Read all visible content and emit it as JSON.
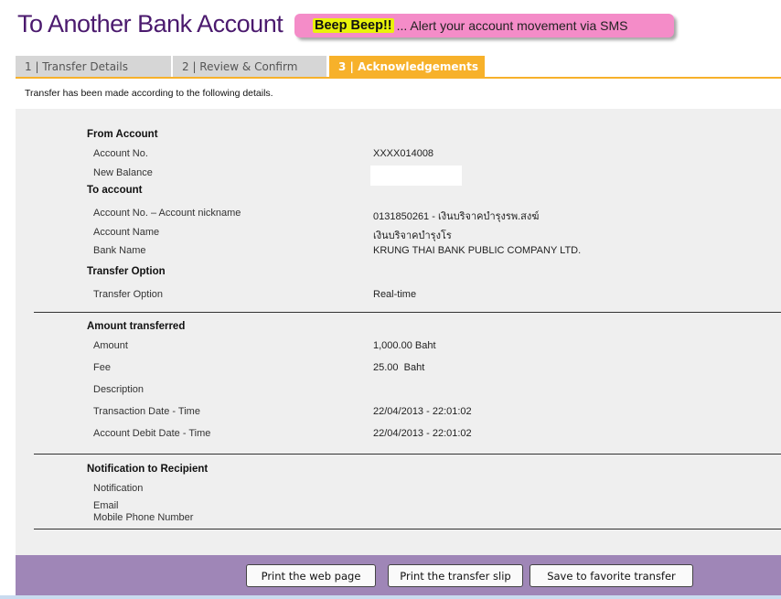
{
  "page": {
    "title": "To Another Bank Account",
    "banner": {
      "highlight": "Beep Beep!!",
      "text": "... Alert your account movement via SMS"
    }
  },
  "tabs": [
    {
      "label": "1 | Transfer Details"
    },
    {
      "label": "2 | Review & Confirm"
    },
    {
      "label": "3 | Acknowledgements"
    }
  ],
  "intro": "Transfer has been made according to the following details.",
  "from_account": {
    "heading": "From Account",
    "account_no_label": "Account No.",
    "account_no_value": "XXXX014008",
    "new_balance_label": "New Balance"
  },
  "to_account": {
    "heading": "To account",
    "account_no_label": "Account No. – Account nickname",
    "account_no_value": "0131850261 - เงินบริจาคบำรุงรพ.สงฆ์",
    "account_name_label": "Account Name",
    "account_name_value": "เงินบริจาคบำรุงโร",
    "bank_name_label": "Bank Name",
    "bank_name_value": "KRUNG THAI BANK PUBLIC COMPANY LTD."
  },
  "transfer_option": {
    "heading": "Transfer Option",
    "label": "Transfer Option",
    "value": "Real-time"
  },
  "amount": {
    "heading": "Amount transferred",
    "amount_label": "Amount",
    "amount_value": "1,000.00 Baht",
    "fee_label": "Fee",
    "fee_value": "25.00  Baht",
    "description_label": "Description",
    "txn_date_label": "Transaction Date - Time",
    "txn_date_value": "22/04/2013 - 22:01:02",
    "debit_date_label": "Account Debit Date - Time",
    "debit_date_value": "22/04/2013 - 22:01:02"
  },
  "notification": {
    "heading": "Notification to Recipient",
    "notification_label": "Notification",
    "email_label": "Email",
    "mobile_label": "Mobile Phone Number"
  },
  "buttons": {
    "print_page": "Print the web page",
    "print_slip": "Print the transfer slip",
    "save_favorite": "Save to favorite transfer"
  }
}
